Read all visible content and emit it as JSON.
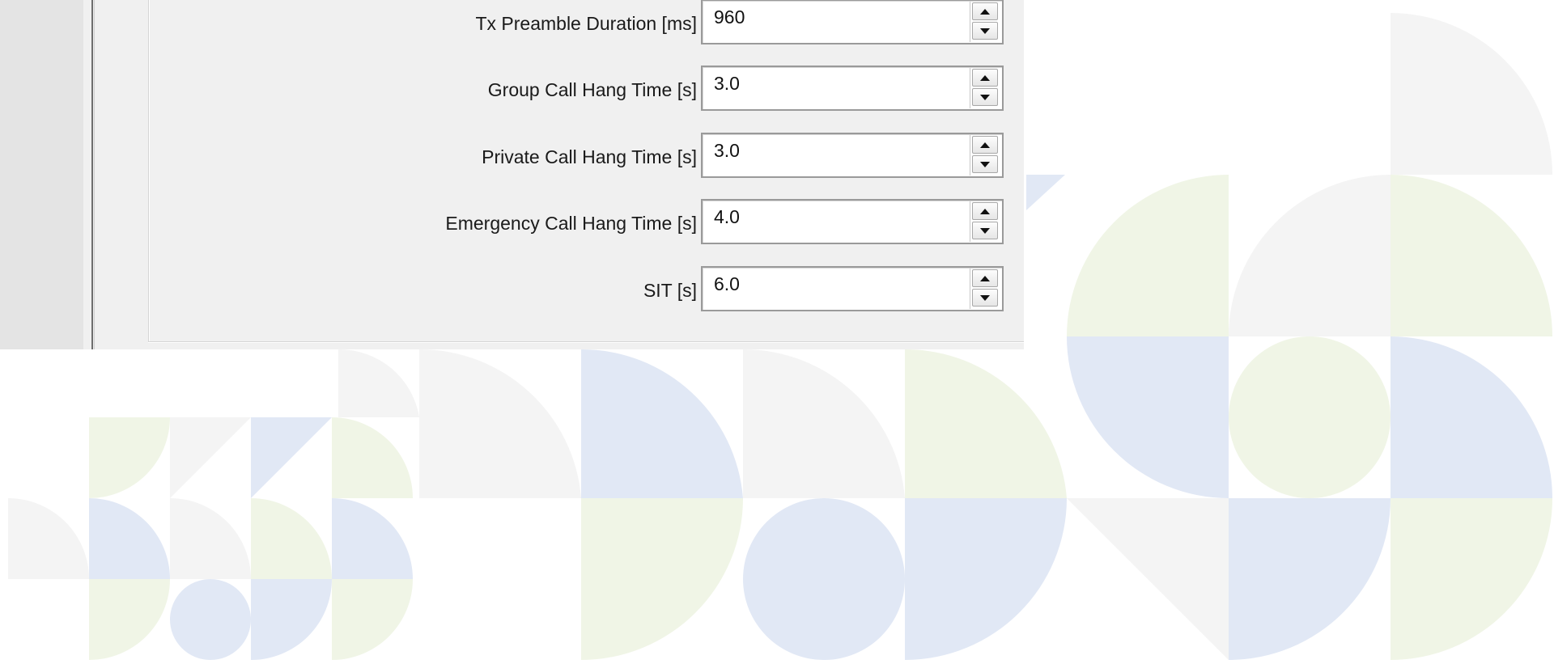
{
  "fields": [
    {
      "label": "Tx Preamble Duration [ms]",
      "value": "960"
    },
    {
      "label": "Group Call Hang Time [s]",
      "value": "3.0"
    },
    {
      "label": "Private Call Hang Time [s]",
      "value": "3.0"
    },
    {
      "label": "Emergency Call Hang Time [s]",
      "value": "4.0"
    },
    {
      "label": "SIT [s]",
      "value": "6.0"
    }
  ],
  "colors": {
    "window_bg": "#f0f0f0",
    "left_panel": "#e4e4e4",
    "pattern_blue": "#e1e8f5",
    "pattern_green": "#f0f5e6",
    "pattern_gray": "#f4f4f4"
  },
  "icons": {
    "spin_up": "triangle-up",
    "spin_down": "triangle-down"
  }
}
